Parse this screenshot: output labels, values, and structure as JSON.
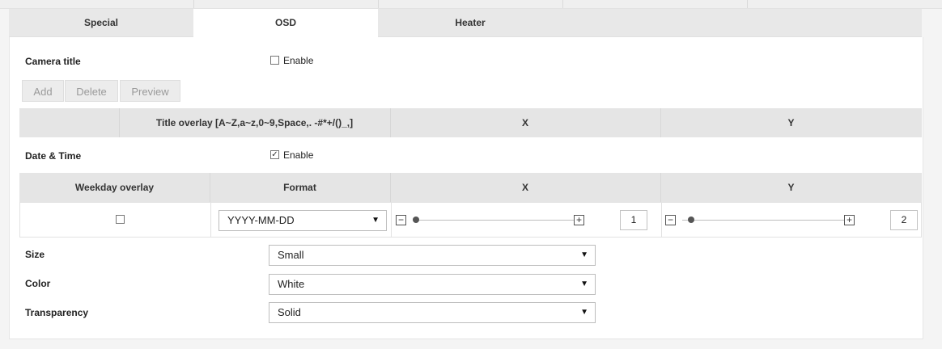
{
  "tabs": [
    {
      "label": "Special"
    },
    {
      "label": "OSD"
    },
    {
      "label": "Heater"
    }
  ],
  "camera_title": {
    "label": "Camera title",
    "enable_label": "Enable",
    "enabled": false
  },
  "buttons": {
    "add": "Add",
    "delete": "Delete",
    "preview": "Preview"
  },
  "title_table": {
    "col_overlay": "Title overlay [A~Z,a~z,0~9,Space,. -#*+/()_,]",
    "col_x": "X",
    "col_y": "Y"
  },
  "date_time": {
    "label": "Date & Time",
    "enable_label": "Enable",
    "enabled": true
  },
  "dt_table": {
    "col_weekday": "Weekday overlay",
    "col_format": "Format",
    "col_x": "X",
    "col_y": "Y",
    "weekday_checked": false,
    "format_value": "YYYY-MM-DD",
    "x_value": "1",
    "y_value": "2",
    "minus_glyph": "−",
    "plus_glyph": "+"
  },
  "settings": {
    "size": {
      "label": "Size",
      "value": "Small"
    },
    "color": {
      "label": "Color",
      "value": "White"
    },
    "transparency": {
      "label": "Transparency",
      "value": "Solid"
    }
  },
  "icons": {
    "dropdown": "chevron-down-icon",
    "check": "checkmark-icon"
  }
}
